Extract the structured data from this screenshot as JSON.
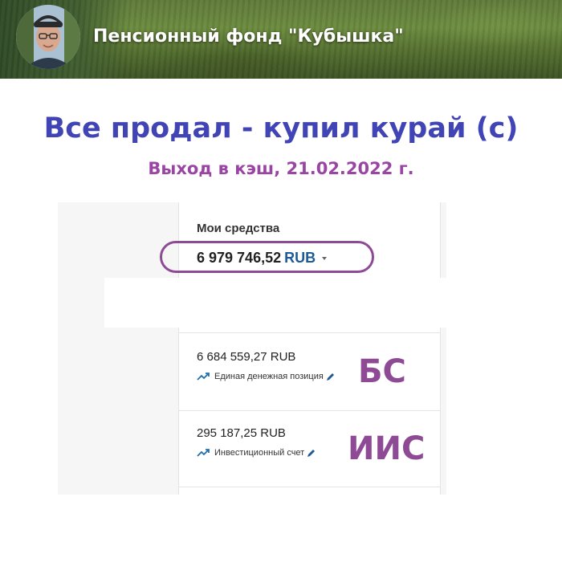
{
  "banner": {
    "title": "Пенсионный фонд \"Кубышка\""
  },
  "headline": "Все продал - купил курай (с)",
  "subline": "Выход в кэш, 21.02.2022 г.",
  "funds": {
    "label": "Мои средства",
    "amount": "6 979 746,52",
    "currency": "RUB"
  },
  "accounts": [
    {
      "amount": "6 684 559,27 RUB",
      "name": "Единая денежная позиция",
      "tag": "БС"
    },
    {
      "amount": "295 187,25 RUB",
      "name": "Инвестиционный счет",
      "tag": "ИИС"
    }
  ],
  "colors": {
    "headline": "#4144b5",
    "accent": "#8e4a95",
    "currency": "#1e5a96",
    "trend": "#1e6fb0"
  }
}
